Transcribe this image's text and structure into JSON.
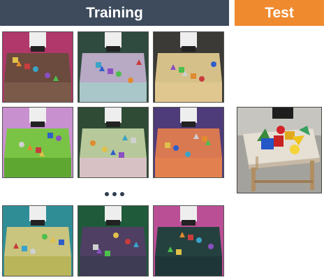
{
  "headers": {
    "training": "Training",
    "test": "Test"
  },
  "colors": {
    "training_header": "#3d4b5c",
    "test_header": "#ef8a2f",
    "ellipsis_dots": "#2f3e50"
  },
  "training_scenes": [
    {
      "bg": "#b0386a",
      "table": "#6b4b3e",
      "front": "#7c5a4a"
    },
    {
      "bg": "#2f4a3e",
      "table": "#b8a9c4",
      "front": "#a9c6c8"
    },
    {
      "bg": "#3b3a36",
      "table": "#d6c08a",
      "front": "#e0c790"
    },
    {
      "bg": "#c990cf",
      "table": "#79c444",
      "front": "#5ea832"
    },
    {
      "bg": "#2f4b35",
      "table": "#b7c99a",
      "front": "#d8c1c4"
    },
    {
      "bg": "#4e3b79",
      "table": "#d87952",
      "front": "#e2814f"
    },
    {
      "bg": "#2f8d96",
      "table": "#c9c47e",
      "front": "#b9b55a"
    },
    {
      "bg": "#1f5a3a",
      "table": "#4e3f63",
      "front": "#3e3b54"
    },
    {
      "bg": "#ba4f96",
      "table": "#25413f",
      "front": "#1f3638"
    }
  ],
  "test_scene": {
    "wall": "#c7c5c0",
    "floor": "#a4a29c",
    "table": "#e5dfd4",
    "leg": "#b08e62"
  }
}
